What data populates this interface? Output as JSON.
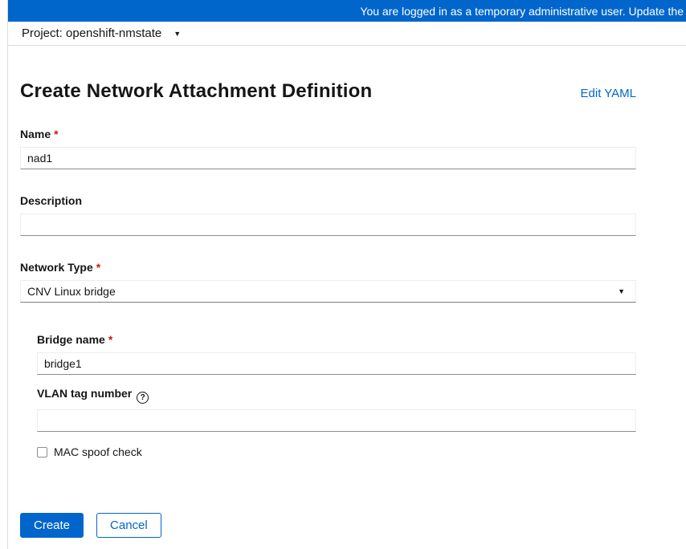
{
  "banner": {
    "text": "You are logged in as a temporary administrative user. Update the",
    "bg_color": "#0066cc"
  },
  "project_bar": {
    "label": "Project: openshift-nmstate"
  },
  "header": {
    "title": "Create Network Attachment Definition",
    "edit_yaml_label": "Edit YAML"
  },
  "form": {
    "required_indicator": "*",
    "name": {
      "label": "Name",
      "required": true,
      "value": "nad1",
      "placeholder": ""
    },
    "description": {
      "label": "Description",
      "required": false,
      "value": "",
      "placeholder": ""
    },
    "network_type": {
      "label": "Network Type",
      "required": true,
      "selected": "CNV Linux bridge"
    },
    "bridge_name": {
      "label": "Bridge name",
      "required": true,
      "value": "bridge1",
      "placeholder": ""
    },
    "vlan": {
      "label": "VLAN tag number",
      "required": false,
      "value": "",
      "placeholder": "",
      "help_glyph": "?"
    },
    "mac_spoof": {
      "label": "MAC spoof check",
      "checked": false
    }
  },
  "actions": {
    "create_label": "Create",
    "cancel_label": "Cancel"
  },
  "icons": {
    "caret_down": "▼"
  },
  "colors": {
    "primary_blue": "#0066cc",
    "link_blue": "#0066cc",
    "required_red": "#c9190b",
    "text": "#151515",
    "input_border": "#ededed",
    "input_border_bottom": "#8a8d90",
    "divider": "#dcdcdc"
  }
}
